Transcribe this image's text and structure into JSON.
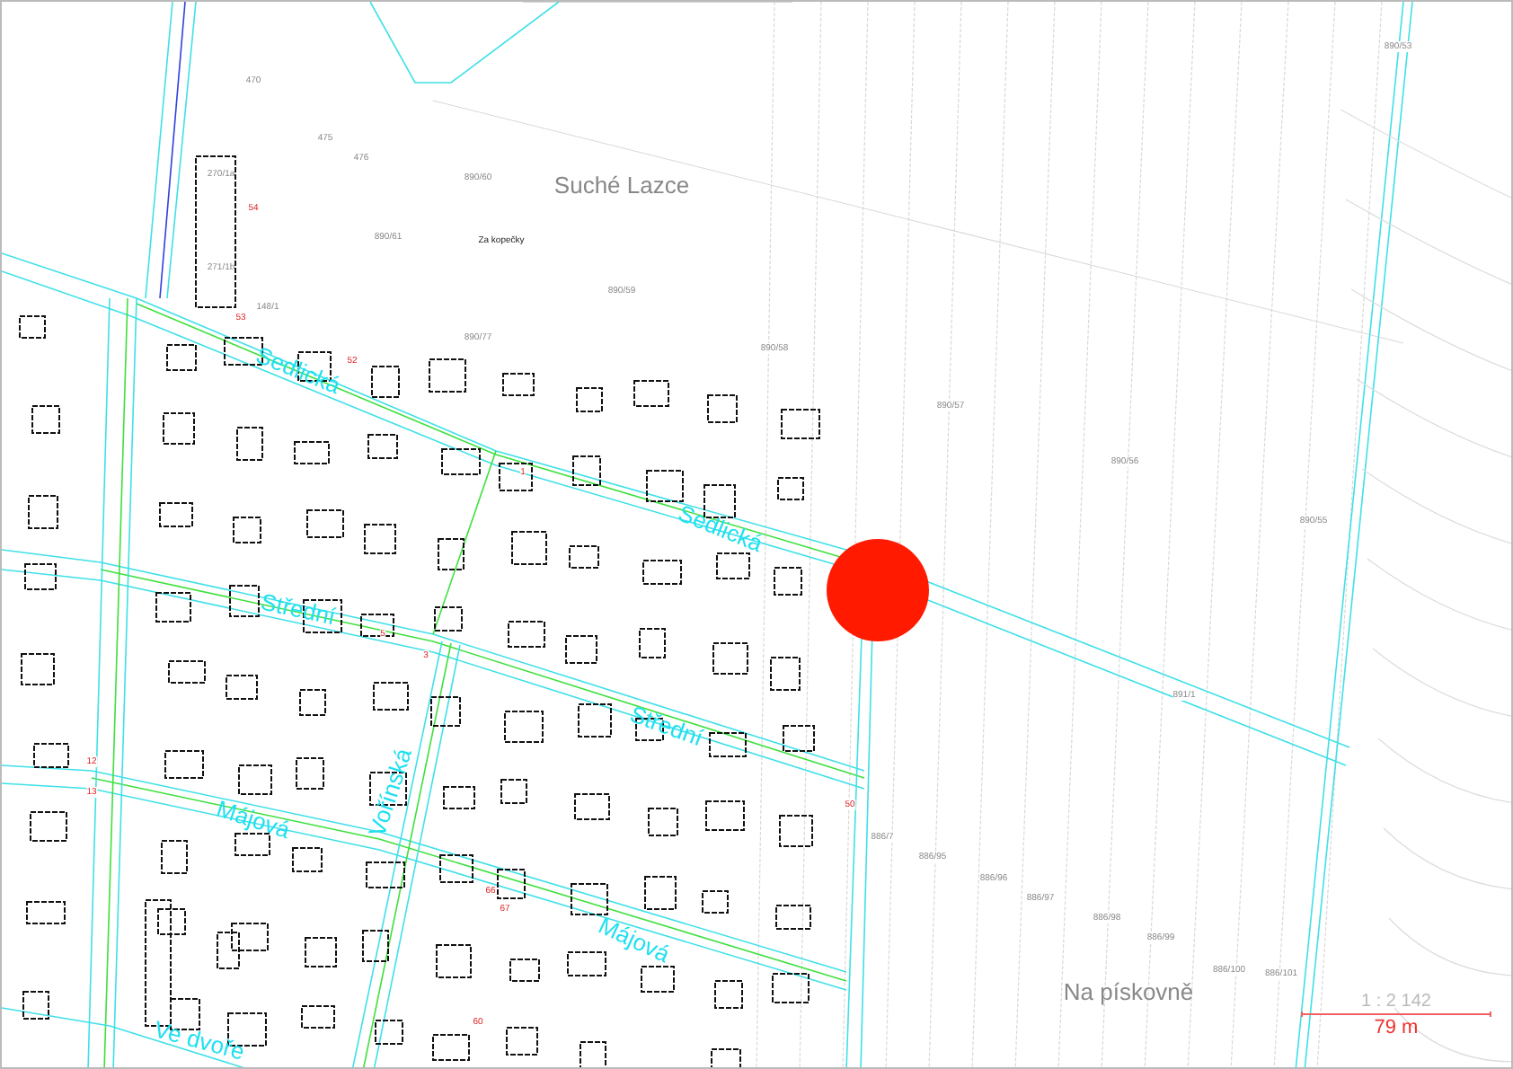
{
  "places": [
    "Suché Lazce",
    "Za kopečky",
    "Na pískovně"
  ],
  "streets": [
    "Sedlická",
    "Sedlická",
    "Střední",
    "Střední",
    "Májová",
    "Májová",
    "Vořínská",
    "Ve dvoře"
  ],
  "parcels": [
    "470",
    "475",
    "476",
    "890/60",
    "890/61",
    "890/59",
    "890/77",
    "890/58",
    "890/57",
    "890/56",
    "890/55",
    "890/53",
    "891/1",
    "886/7",
    "886/95",
    "886/96",
    "886/97",
    "886/98",
    "886/99",
    "886/100",
    "886/101",
    "270/1a",
    "271/1b",
    "148/1"
  ],
  "points": [
    "54",
    "53",
    "52",
    "1",
    "5",
    "3",
    "12",
    "13",
    "66",
    "67",
    "60",
    "50"
  ],
  "scale": {
    "ratio": "1 : 2 142",
    "length": "79 m"
  }
}
